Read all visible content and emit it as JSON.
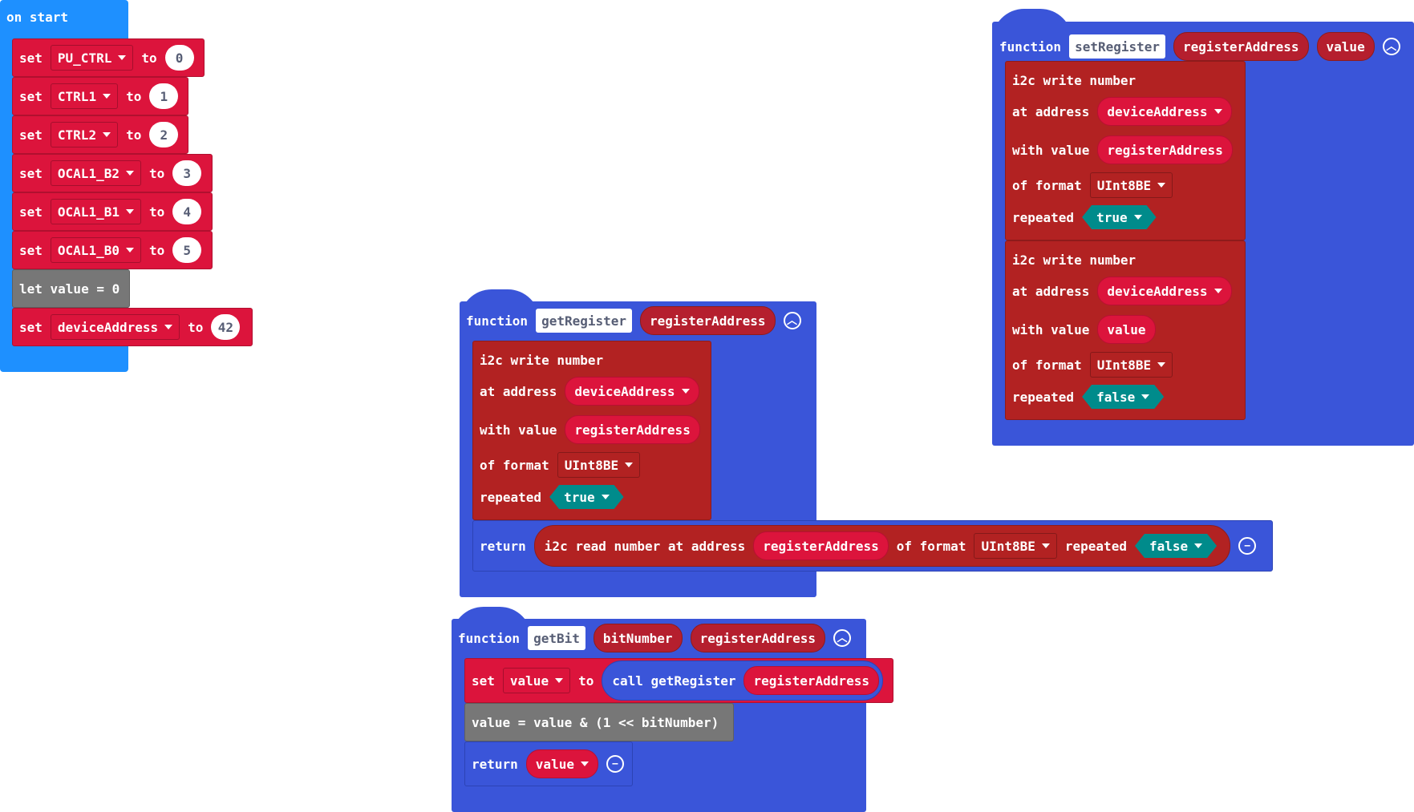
{
  "on_start": {
    "header": "on start",
    "set_kw": "set",
    "to_kw": "to",
    "assignments": [
      {
        "variable": "PU_CTRL",
        "value": "0"
      },
      {
        "variable": "CTRL1",
        "value": "1"
      },
      {
        "variable": "CTRL2",
        "value": "2"
      },
      {
        "variable": "OCAL1_B2",
        "value": "3"
      },
      {
        "variable": "OCAL1_B1",
        "value": "4"
      },
      {
        "variable": "OCAL1_B0",
        "value": "5"
      }
    ],
    "let_statement": "let value = 0",
    "final_assignment": {
      "variable": "deviceAddress",
      "value": "42"
    }
  },
  "set_register": {
    "keyword": "function",
    "name": "setRegister",
    "params": [
      "registerAddress",
      "value"
    ],
    "writes": [
      {
        "title": "i2c write number",
        "address_label": "at address",
        "address": "deviceAddress",
        "value_label": "with value",
        "value": "registerAddress",
        "format_label": "of format",
        "format": "UInt8BE",
        "repeated_label": "repeated",
        "repeated": "true"
      },
      {
        "title": "i2c write number",
        "address_label": "at address",
        "address": "deviceAddress",
        "value_label": "with value",
        "value": "value",
        "format_label": "of format",
        "format": "UInt8BE",
        "repeated_label": "repeated",
        "repeated": "false"
      }
    ]
  },
  "get_register": {
    "keyword": "function",
    "name": "getRegister",
    "param": "registerAddress",
    "write": {
      "title": "i2c write number",
      "address_label": "at address",
      "address": "deviceAddress",
      "value_label": "with value",
      "value": "registerAddress",
      "format_label": "of format",
      "format": "UInt8BE",
      "repeated_label": "repeated",
      "repeated": "true"
    },
    "return_kw": "return",
    "read": {
      "label": "i2c read number at address",
      "address": "registerAddress",
      "format_label": "of format",
      "format": "UInt8BE",
      "repeated_label": "repeated",
      "repeated": "false"
    }
  },
  "get_bit": {
    "keyword": "function",
    "name": "getBit",
    "params": [
      "bitNumber",
      "registerAddress"
    ],
    "set_kw": "set",
    "set_var": "value",
    "to_kw": "to",
    "call_label": "call getRegister",
    "call_arg": "registerAddress",
    "expression": "value = value & (1 << bitNumber)",
    "return_kw": "return",
    "return_var": "value"
  },
  "colors": {
    "function_block": "#3a55d9",
    "event_block": "#1e90ff",
    "variables": "#dc143c",
    "i2c_pins": "#b22222",
    "logic": "#008b8b",
    "code": "#777777"
  },
  "icons": [
    "chevron-down-icon",
    "collapse-up-icon",
    "remove-minus-icon"
  ]
}
